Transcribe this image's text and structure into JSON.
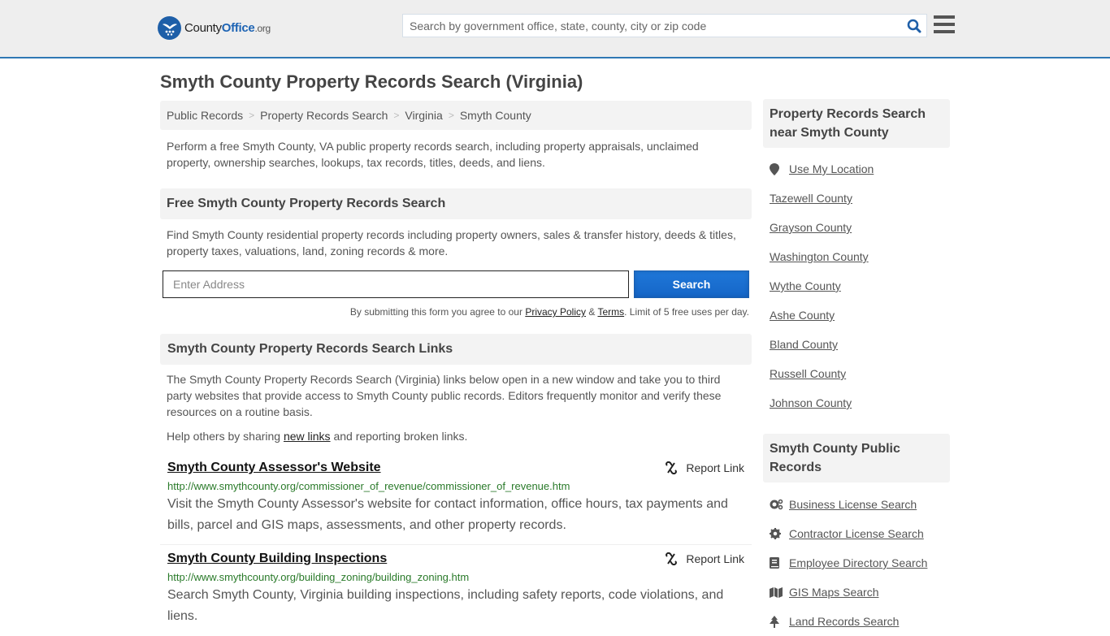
{
  "header": {
    "logo": {
      "county": "County",
      "office": "Office",
      "org": ".org"
    },
    "search_placeholder": "Search by government office, state, county, city or zip code"
  },
  "page_title": "Smyth County Property Records Search (Virginia)",
  "breadcrumb": [
    "Public Records",
    "Property Records Search",
    "Virginia",
    "Smyth County"
  ],
  "intro": "Perform a free Smyth County, VA public property records search, including property appraisals, unclaimed property, ownership searches, lookups, tax records, titles, deeds, and liens.",
  "free_search": {
    "heading": "Free Smyth County Property Records Search",
    "description": "Find Smyth County residential property records including property owners, sales & transfer history, deeds & titles, property taxes, valuations, land, zoning records & more.",
    "input_placeholder": "Enter Address",
    "button_label": "Search",
    "disclaimer_pre": "By submitting this form you agree to our ",
    "privacy_label": "Privacy Policy",
    "amp": " & ",
    "terms_label": "Terms",
    "disclaimer_post": ". Limit of 5 free uses per day."
  },
  "links_section": {
    "heading": "Smyth County Property Records Search Links",
    "description": "The Smyth County Property Records Search (Virginia) links below open in a new window and take you to third party websites that provide access to Smyth County public records. Editors frequently monitor and verify these resources on a routine basis.",
    "help_pre": "Help others by sharing ",
    "help_link": "new links",
    "help_post": " and reporting broken links.",
    "report_label": "Report Link",
    "items": [
      {
        "title": "Smyth County Assessor's Website",
        "url": "http://www.smythcounty.org/commissioner_of_revenue/commissioner_of_revenue.htm",
        "description": "Visit the Smyth County Assessor's website for contact information, office hours, tax payments and bills, parcel and GIS maps, assessments, and other property records."
      },
      {
        "title": "Smyth County Building Inspections",
        "url": "http://www.smythcounty.org/building_zoning/building_zoning.htm",
        "description": "Search Smyth County, Virginia building inspections, including safety reports, code violations, and liens."
      }
    ]
  },
  "sidebar": {
    "nearby_heading": "Property Records Search near Smyth County",
    "use_location": "Use My Location",
    "nearby": [
      "Tazewell County",
      "Grayson County",
      "Washington County",
      "Wythe County",
      "Ashe County",
      "Bland County",
      "Russell County",
      "Johnson County"
    ],
    "public_heading": "Smyth County Public Records",
    "public_records": [
      {
        "label": "Business License Search",
        "icon": "cogs-icon"
      },
      {
        "label": "Contractor License Search",
        "icon": "gear-icon"
      },
      {
        "label": "Employee Directory Search",
        "icon": "book-icon"
      },
      {
        "label": "GIS Maps Search",
        "icon": "map-icon"
      },
      {
        "label": "Land Records Search",
        "icon": "tree-icon"
      }
    ]
  },
  "colors": {
    "accent": "#2f78b4",
    "button": "#1a6fd0",
    "url_green": "#2a7a2a"
  }
}
